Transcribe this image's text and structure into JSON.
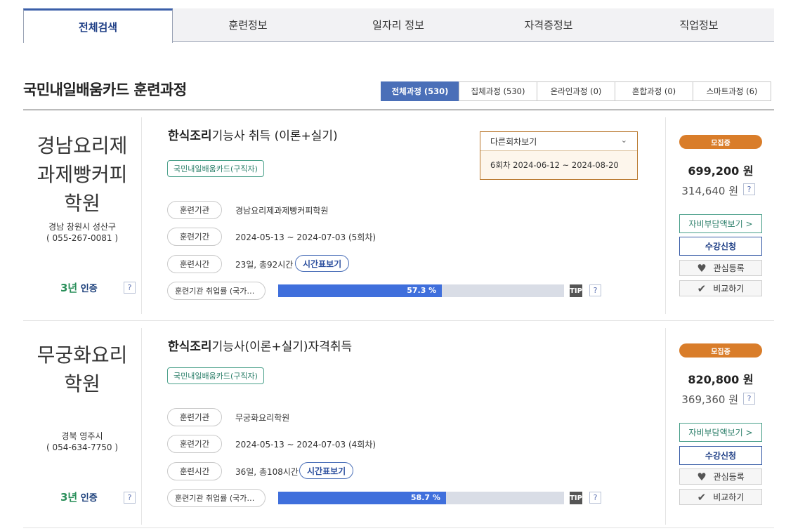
{
  "tabs": [
    "전체검색",
    "훈련정보",
    "일자리 정보",
    "자격증정보",
    "직업정보"
  ],
  "section_title": "국민내일배움카드 훈련과정",
  "filters": [
    "전체과정 (530)",
    "집체과정 (530)",
    "온라인과정 (0)",
    "혼합과정 (0)",
    "스마트과정 (6)"
  ],
  "labels": {
    "org": "훈련기관",
    "period": "훈련기간",
    "time": "훈련시간",
    "employment": "훈련기관 취업률 (국가…",
    "timetable": "시간표보기",
    "tip": "TIP",
    "q": "?",
    "cert_three": "3년",
    "cert_text": "인증",
    "badge": "국민내일배움카드(구직자)",
    "status": "모집중",
    "self_pay": "자비부담액보기 >",
    "apply": "수강신청",
    "interest": "관심등록",
    "compare": "비교하기",
    "other_rounds": "다른회차보기"
  },
  "courses": [
    {
      "inst_name": "경남요리제과제빵커피학원",
      "inst_name_lines": [
        "경남요리제",
        "과제빵커피",
        "학원"
      ],
      "address": "경남 창원시 성산구",
      "phone": "( 055-267-0081 )",
      "title_bold": "한식조리",
      "title_rest": "기능사 취득 (이론+실기)",
      "org": "경남요리제과제빵커피학원",
      "period": "2024-05-13 ~ 2024-07-03 (5회차)",
      "time": "23일, 총92시간",
      "employment_rate": 57.3,
      "employment_label": "57.3 %",
      "price": "699,200 원",
      "self_pay": "314,640 원",
      "other_round": "6회차 2024-06-12 ~ 2024-08-20"
    },
    {
      "inst_name": "무궁화요리학원",
      "inst_name_lines": [
        "무궁화요리",
        "학원"
      ],
      "address": "경북 영주시",
      "phone": "( 054-634-7750 )",
      "title_bold": "한식조리",
      "title_rest": "기능사(이론+실기)자격취득",
      "org": "무궁화요리학원",
      "period": "2024-05-13 ~ 2024-07-03 (4회차)",
      "time": "36일, 총108시간",
      "employment_rate": 58.7,
      "employment_label": "58.7 %",
      "price": "820,800 원",
      "self_pay": "369,360 원"
    }
  ]
}
